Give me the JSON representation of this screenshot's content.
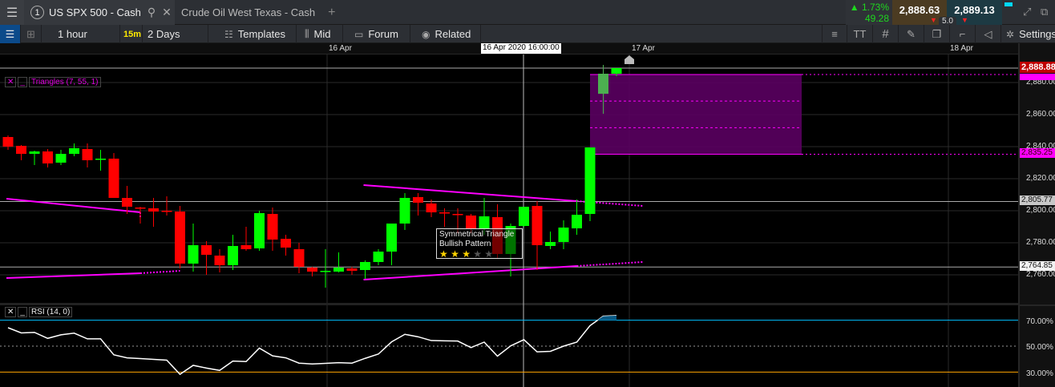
{
  "topbar": {
    "menu_icon": "hamburger-icon",
    "tabs": [
      {
        "number": "1",
        "label": "US SPX 500 - Cash",
        "active": true
      },
      {
        "label": "Crude Oil West Texas - Cash",
        "active": false
      }
    ],
    "add_tab": "+",
    "change_pct": "1.73%",
    "change_pts": "49.28",
    "sell": "2,888.63",
    "buy": "2,889.13",
    "spread": "5.0"
  },
  "toolbar": {
    "interval": "1 hour",
    "interval_badge": "15m",
    "range": "2 Days",
    "templates": "Templates",
    "price_type": "Mid",
    "forum": "Forum",
    "related": "Related",
    "text_tool": "TT",
    "settings": "Settings"
  },
  "time_axis": {
    "labels": [
      "16 Apr",
      "17 Apr",
      "18 Apr"
    ],
    "crosshair": "16 Apr 2020 16:00:00"
  },
  "price_axis": {
    "labels": [
      "2,880.00",
      "2,860.00",
      "2,840.00",
      "2,820.00",
      "2,800.00",
      "2,780.00",
      "2,760.00"
    ],
    "last_price": "2,888.88",
    "target_price": "2,835.25",
    "upper_line": "2,805.77",
    "lower_line": "2,764.85"
  },
  "indicators": {
    "triangles": "Triangles (7, 55, 1)",
    "rsi": "RSI (14, 0)"
  },
  "rsi_axis": [
    "70.00%",
    "50.00%",
    "30.00%"
  ],
  "pattern": {
    "title": "Symmetrical Triangle",
    "subtitle": "Bullish Pattern",
    "rating": 3,
    "max_rating": 5
  },
  "colors": {
    "up": "#00ff00",
    "down": "#ff0000",
    "pattern": "#ff00ff",
    "rsi_upper": "#00bfff",
    "rsi_lower": "#ffa500"
  },
  "chart_data": {
    "type": "candlestick",
    "ohlc": [
      [
        2846,
        2847,
        2838,
        2840
      ],
      [
        2840.5,
        2841,
        2831.5,
        2835.5
      ],
      [
        2835.5,
        2837.5,
        2828.5,
        2837
      ],
      [
        2837,
        2838.5,
        2827,
        2829.5
      ],
      [
        2830,
        2838,
        2828.5,
        2835.5
      ],
      [
        2835.5,
        2842,
        2834,
        2839
      ],
      [
        2838.5,
        2842,
        2827,
        2831.5
      ],
      [
        2832,
        2838,
        2825,
        2832.5
      ],
      [
        2832.5,
        2836,
        2808,
        2808
      ],
      [
        2808,
        2815.5,
        2798,
        2802.5
      ],
      [
        2802,
        2802.5,
        2792,
        2801.5
      ],
      [
        2801.5,
        2808,
        2790,
        2799.5
      ],
      [
        2800,
        2809,
        2797,
        2799.5
      ],
      [
        2799.5,
        2803,
        2764,
        2767
      ],
      [
        2767,
        2792,
        2762,
        2778.5
      ],
      [
        2778.5,
        2781,
        2760,
        2772.5
      ],
      [
        2772,
        2776,
        2761.5,
        2766
      ],
      [
        2766,
        2785,
        2763,
        2778
      ],
      [
        2778.5,
        2790,
        2775,
        2776
      ],
      [
        2776.5,
        2800,
        2775,
        2798.5
      ],
      [
        2798,
        2802,
        2775,
        2782
      ],
      [
        2782.5,
        2785,
        2772,
        2777
      ],
      [
        2776,
        2780,
        2761,
        2765
      ],
      [
        2764.5,
        2765,
        2759,
        2762
      ],
      [
        2762,
        2776,
        2752,
        2762.5
      ],
      [
        2762,
        2774,
        2761.5,
        2764.5
      ],
      [
        2764,
        2765,
        2760,
        2762.5
      ],
      [
        2763,
        2769,
        2757.5,
        2768
      ],
      [
        2768,
        2776,
        2766,
        2774.5
      ],
      [
        2774.5,
        2792,
        2766,
        2792
      ],
      [
        2792,
        2811,
        2788,
        2808
      ],
      [
        2808.5,
        2811,
        2797,
        2805
      ],
      [
        2804.5,
        2807,
        2796,
        2799
      ],
      [
        2799,
        2801.5,
        2790,
        2798.5
      ],
      [
        2798,
        2801.5,
        2786,
        2797.5
      ],
      [
        2797,
        2798,
        2786,
        2788.5
      ],
      [
        2788.5,
        2808,
        2785,
        2796.5
      ],
      [
        2796,
        2804,
        2770,
        2773
      ],
      [
        2773,
        2792,
        2759,
        2790.5
      ],
      [
        2790.5,
        2802.5,
        2790,
        2802.5
      ],
      [
        2803,
        2806,
        2763,
        2778.5
      ],
      [
        2778,
        2787,
        2776,
        2780.5
      ],
      [
        2780.5,
        2794,
        2776,
        2789.5
      ],
      [
        2789,
        2807,
        2785,
        2797.5
      ],
      [
        2798,
        2839.5,
        2793.5,
        2839.5
      ],
      [
        2873,
        2891,
        2860.5,
        2885.5
      ],
      [
        2885.5,
        2889,
        2884,
        2889
      ]
    ],
    "rsi": [
      64.2,
      60.2,
      60.6,
      56,
      58.7,
      60,
      55.6,
      55.6,
      43.3,
      41,
      40.4,
      39.8,
      39.2,
      28.3,
      35.2,
      33.1,
      31.3,
      38.5,
      38.1,
      48.5,
      42.5,
      41,
      36.9,
      36.3,
      36.7,
      37.3,
      36.9,
      40.6,
      43.9,
      53.3,
      59.1,
      57.2,
      54.3,
      54.1,
      53.9,
      48.9,
      53.1,
      42.3,
      50.2,
      55,
      45.6,
      46,
      50,
      53.1,
      65.8,
      73.1,
      73.5
    ],
    "ylim": [
      2750,
      2895
    ],
    "triangles": [
      {
        "upper": [
          [
            0,
            2807.5
          ],
          [
            10,
            2799
          ]
        ],
        "upper_proj": [
          10,
          2796
        ],
        "lower": [
          [
            0,
            2758
          ],
          [
            10,
            2761
          ]
        ],
        "lower_proj": [
          13,
          2762.5
        ]
      },
      {
        "upper": [
          [
            27,
            2816
          ],
          [
            43,
            2806
          ]
        ],
        "upper_proj": [
          48,
          2803
        ],
        "lower": [
          [
            27,
            2757
          ],
          [
            43,
            2765.5
          ]
        ],
        "lower_proj": [
          48,
          2768
        ]
      }
    ],
    "target_zone": [
      2835.25,
      2885
    ]
  }
}
